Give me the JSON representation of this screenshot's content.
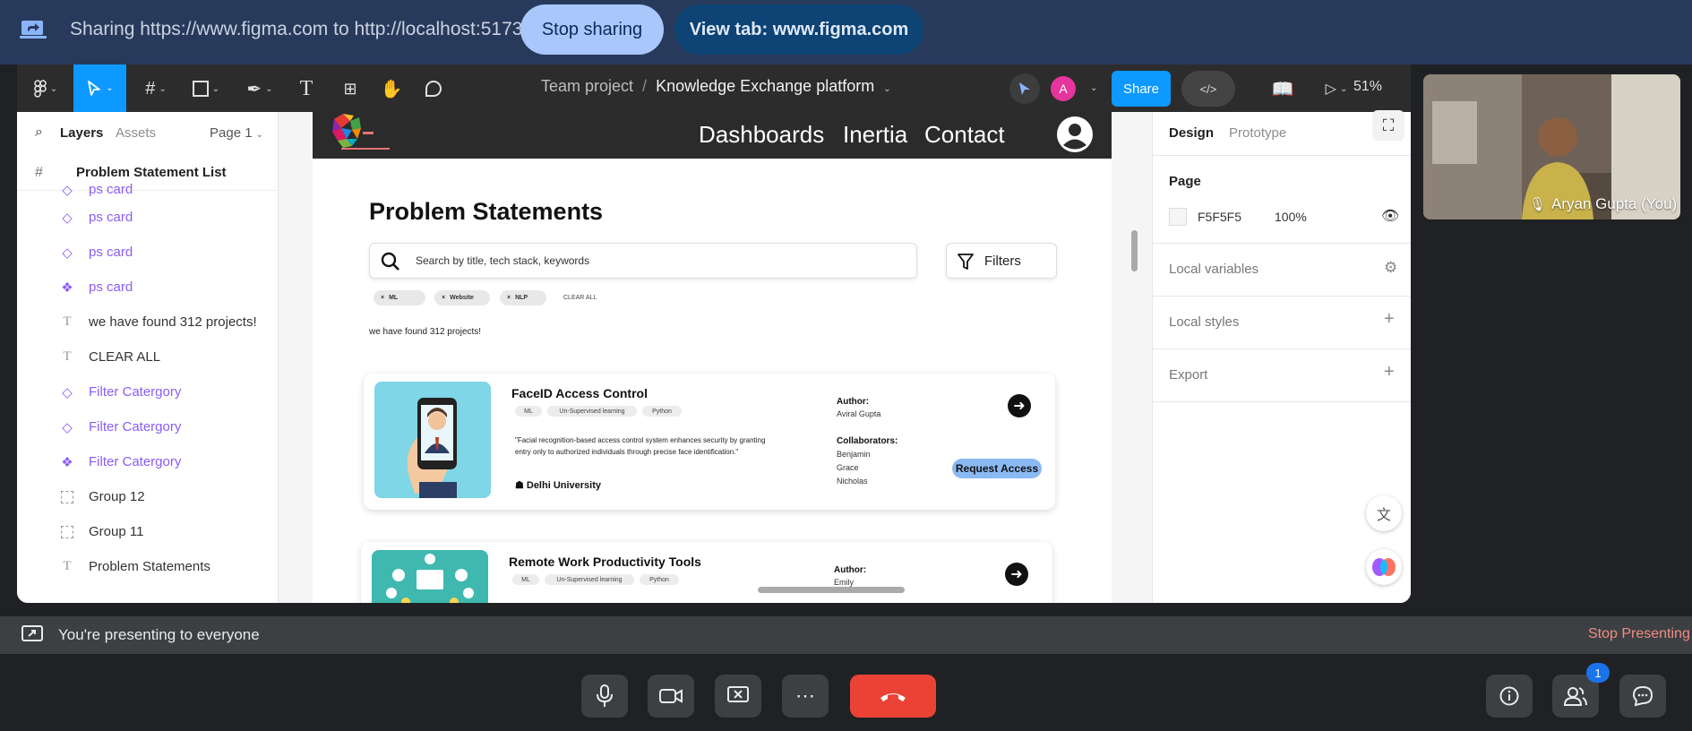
{
  "share_banner": {
    "text": "Sharing https://www.figma.com to http://localhost:5173",
    "stop_label": "Stop sharing",
    "view_tab_label": "View tab: www.figma.com"
  },
  "figma": {
    "toolbar": {
      "project": "Team project",
      "separator": "/",
      "file_name": "Knowledge Exchange platform",
      "avatar_initial": "A",
      "share_label": "Share",
      "zoom": "51%"
    },
    "layers": {
      "tab_layers": "Layers",
      "tab_assets": "Assets",
      "page_select": "Page 1",
      "frame_name": "Problem Statement List",
      "items": [
        {
          "label": "ps card",
          "kind": "component-instance"
        },
        {
          "label": "ps card",
          "kind": "component-instance"
        },
        {
          "label": "ps card",
          "kind": "component-instance"
        },
        {
          "label": "ps card",
          "kind": "component"
        },
        {
          "label": "we have found 312 projects!",
          "kind": "text"
        },
        {
          "label": "CLEAR ALL",
          "kind": "text"
        },
        {
          "label": "Filter Catergory",
          "kind": "component-instance"
        },
        {
          "label": "Filter Catergory",
          "kind": "component-instance"
        },
        {
          "label": "Filter Catergory",
          "kind": "component"
        },
        {
          "label": "Group 12",
          "kind": "group"
        },
        {
          "label": "Group 11",
          "kind": "group"
        },
        {
          "label": "Problem Statements",
          "kind": "text"
        }
      ]
    },
    "canvas": {
      "nav": {
        "dashboards": "Dashboards",
        "inertia": "Inertia",
        "contact": "Contact"
      },
      "title": "Problem Statements",
      "search_placeholder": "Search by title, tech stack, keywords",
      "filters_label": "Filters",
      "chips": [
        "ML",
        "Website",
        "NLP"
      ],
      "chip_remove": "×",
      "clear_all": "CLEAR ALL",
      "found_text": "we have found 312 projects!",
      "cards": [
        {
          "title": "FaceID Access Control",
          "tags": [
            "ML",
            "Un-Supervised learning",
            "Python"
          ],
          "description_line1": "\"Facial recognition-based access control system enhances security by granting",
          "description_line2": "entry only to authorized individuals through precise face identification.\"",
          "university": "Delhi University",
          "author_label": "Author:",
          "author": "Aviral Gupta",
          "collab_label": "Collaborators:",
          "collaborators": [
            "Benjamin",
            "Grace",
            "Nicholas"
          ],
          "request_label": "Request Access"
        },
        {
          "title": "Remote Work Productivity Tools",
          "tags": [
            "ML",
            "Un-Supervised learning",
            "Python"
          ],
          "author_label": "Author:",
          "author": "Emily"
        }
      ]
    },
    "design_panel": {
      "tab_design": "Design",
      "tab_prototype": "Prototype",
      "page_label": "Page",
      "page_color_hex": "F5F5F5",
      "page_opacity": "100%",
      "local_variables": "Local variables",
      "local_styles": "Local styles",
      "export": "Export"
    }
  },
  "participant": {
    "name": "Aryan Gupta (You)"
  },
  "presenting": {
    "text": "You're presenting to everyone",
    "stop_label": "Stop Presenting"
  },
  "controls": {
    "people_badge": "1"
  },
  "colors": {
    "share_bar": "#283a5c",
    "figma_blue": "#0d99ff",
    "component_purple": "#8b5cf6",
    "end_call": "#ea4335",
    "stop_present": "#f28b82"
  }
}
